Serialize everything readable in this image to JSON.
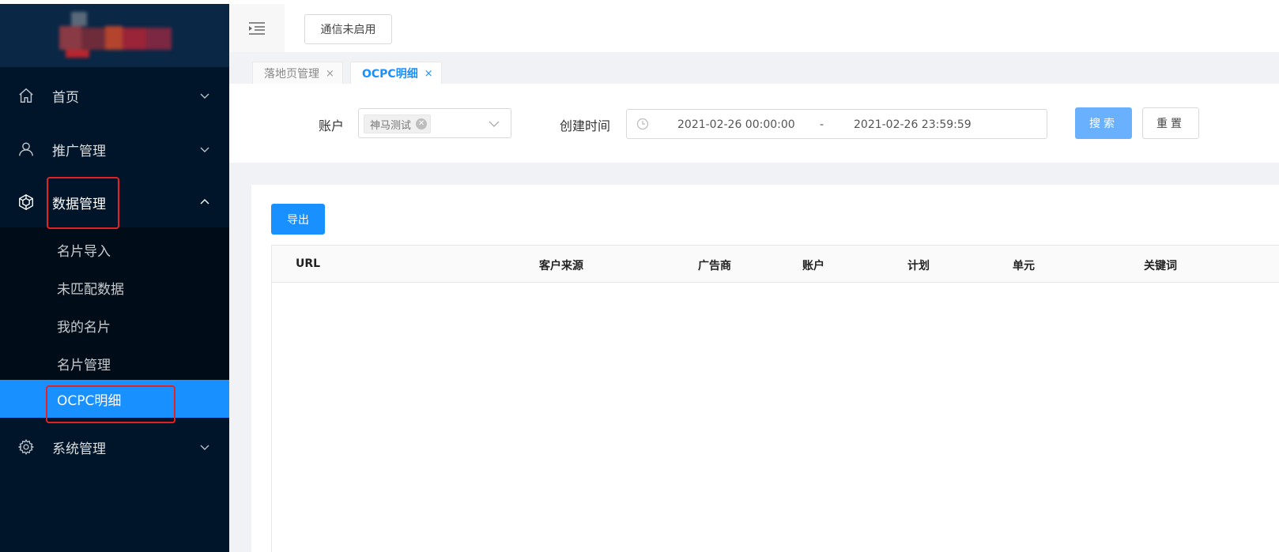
{
  "colors": {
    "sidebar_bg": "#001529",
    "submenu_bg": "#000c17",
    "primary": "#1890ff",
    "highlight_box": "#e52222"
  },
  "sidebar": {
    "menu": [
      {
        "label": "首页",
        "icon": "home-icon",
        "expanded": false
      },
      {
        "label": "推广管理",
        "icon": "user-icon",
        "expanded": false
      },
      {
        "label": "数据管理",
        "icon": "cube-icon",
        "expanded": true
      },
      {
        "label": "系统管理",
        "icon": "gear-icon",
        "expanded": false
      }
    ],
    "data_submenu": [
      {
        "label": "名片导入",
        "active": false
      },
      {
        "label": "未匹配数据",
        "active": false
      },
      {
        "label": "我的名片",
        "active": false
      },
      {
        "label": "名片管理",
        "active": false
      },
      {
        "label": "OCPC明细",
        "active": true
      }
    ]
  },
  "header": {
    "fold_icon": "menu-fold-icon",
    "comm_button": "通信未启用"
  },
  "tabs": [
    {
      "label": "落地页管理",
      "active": false,
      "close": "×"
    },
    {
      "label": "OCPC明细",
      "active": true,
      "close": "×"
    }
  ],
  "search": {
    "account_label": "账户",
    "account_tag": "神马测试",
    "created_label": "创建时间",
    "start": "2021-02-26 00:00:00",
    "separator": "-",
    "end": "2021-02-26 23:59:59",
    "search_button": "搜索",
    "reset_button": "重置"
  },
  "table": {
    "export_button": "导出",
    "columns": [
      "URL",
      "客户来源",
      "广告商",
      "账户",
      "计划",
      "单元",
      "关键词"
    ],
    "rows": []
  }
}
